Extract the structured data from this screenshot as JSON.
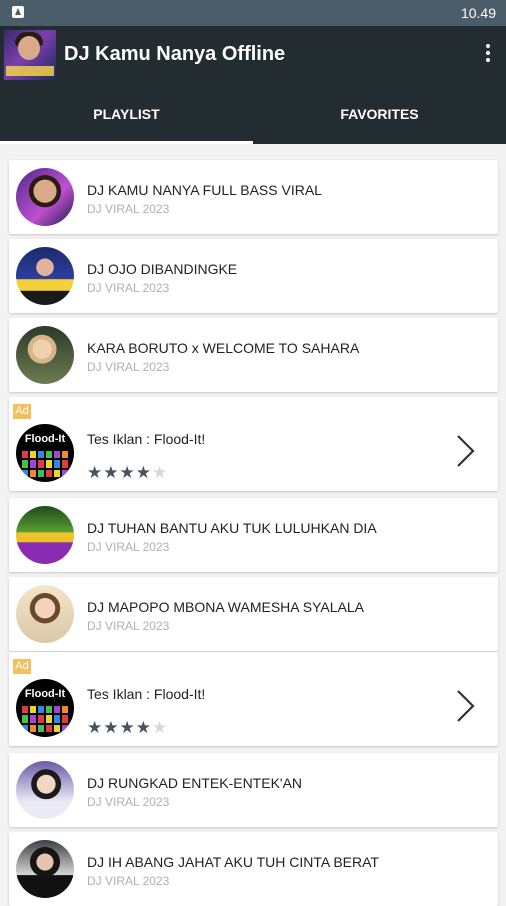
{
  "status_bar": {
    "time": "10.49",
    "notification_icon": "app-notification-icon"
  },
  "app_bar": {
    "title": "DJ Kamu Nanya Offline",
    "menu_icon": "overflow-menu-icon"
  },
  "tabs": [
    {
      "label": "PLAYLIST",
      "active": true
    },
    {
      "label": "FAVORITES",
      "active": false
    }
  ],
  "colors": {
    "app_bar": "#232c31",
    "status_bar": "#4a5d68",
    "ad_badge": "#f3c060",
    "star_on": "#455560",
    "star_off": "#d7d7d7"
  },
  "songs": [
    {
      "title": "DJ KAMU NANYA FULL BASS VIRAL",
      "subtitle": "DJ VIRAL 2023"
    },
    {
      "title": "DJ OJO DIBANDINGKE",
      "subtitle": "DJ VIRAL 2023"
    },
    {
      "title": "KARA BORUTO x WELCOME TO SAHARA",
      "subtitle": "DJ VIRAL 2023"
    },
    {
      "title": "DJ TUHAN BANTU AKU TUK LULUHKAN DIA",
      "subtitle": "DJ VIRAL 2023"
    },
    {
      "title": "DJ MAPOPO MBONA WAMESHA SYALALA",
      "subtitle": "DJ VIRAL 2023"
    },
    {
      "title": "DJ RUNGKAD ENTEK-ENTEK'AN",
      "subtitle": "DJ VIRAL 2023"
    },
    {
      "title": "DJ IH ABANG JAHAT AKU TUH CINTA BERAT",
      "subtitle": "DJ VIRAL 2023"
    }
  ],
  "ads": [
    {
      "badge": "Ad",
      "title": "Tes Iklan : Flood-It!",
      "thumb_text": "Flood-It",
      "rating": 4,
      "max_rating": 5
    },
    {
      "badge": "Ad",
      "title": "Tes Iklan : Flood-It!",
      "thumb_text": "Flood-It",
      "rating": 4,
      "max_rating": 5
    }
  ]
}
